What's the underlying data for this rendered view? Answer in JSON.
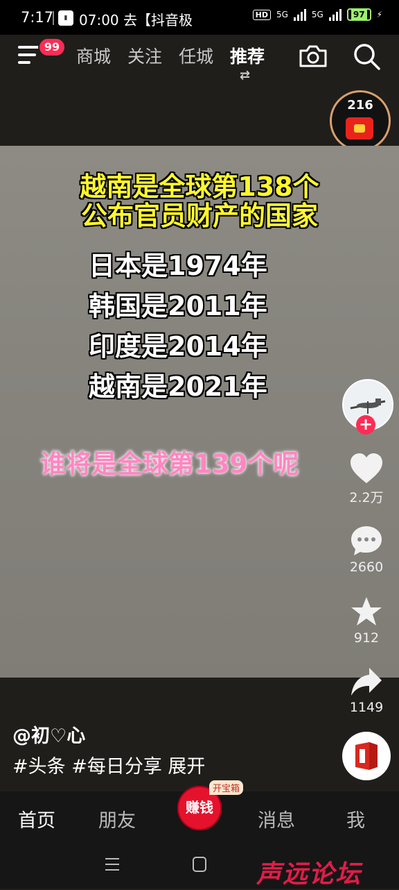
{
  "status_bar": {
    "time": "7:17",
    "notification": "07:00 去【抖音极",
    "hd": "HD",
    "network1": "5G",
    "network2": "5G",
    "battery": "97"
  },
  "top_nav": {
    "badge": "99",
    "tabs": [
      "商城",
      "关注",
      "任城",
      "推荐"
    ],
    "active_tab": "推荐",
    "swap_symbol": "⇄"
  },
  "coin_widget": {
    "count": "216"
  },
  "video": {
    "title_line1": "越南是全球第138个",
    "title_line2": "公布官员财产的国家",
    "lines": [
      "日本是1974年",
      "韩国是2011年",
      "印度是2014年",
      "越南是2021年"
    ],
    "question": "谁将是全球第139个呢"
  },
  "actions": {
    "likes": "2.2万",
    "comments": "2660",
    "favorites": "912",
    "shares": "1149",
    "follow_symbol": "+"
  },
  "post": {
    "author": "@初♡心",
    "caption": "#头条 #每日分享 展开"
  },
  "bottom_nav": {
    "home": "首页",
    "friends": "朋友",
    "earn": "赚钱",
    "earn_tag": "开宝箱",
    "messages": "消息",
    "me": "我"
  },
  "watermark": "声远论坛",
  "colors": {
    "accent": "#fe2c55",
    "title_yellow": "#fff82e",
    "question_pink": "#ff86c2"
  }
}
